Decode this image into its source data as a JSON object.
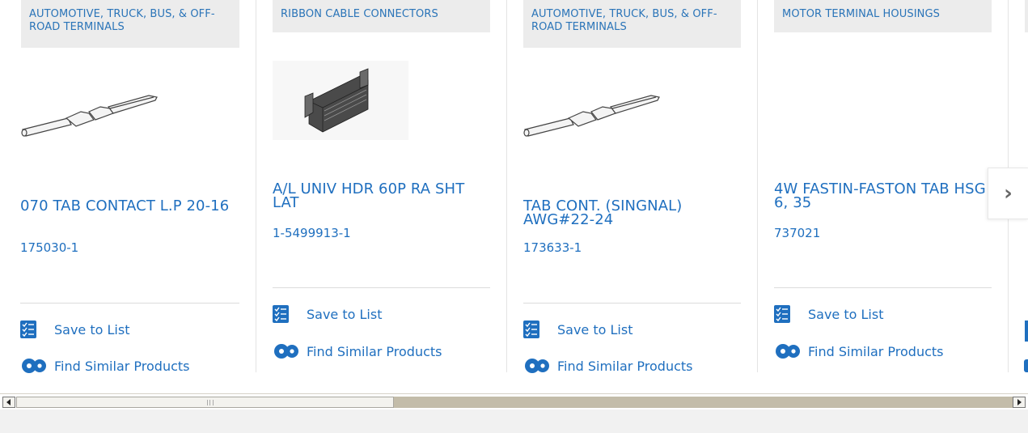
{
  "cards": [
    {
      "category": "AUTOMOTIVE, TRUCK, BUS, & OFF-ROAD TERMINALS",
      "name": "070 TAB CONTACT L.P 20-16",
      "part_number": "175030-1",
      "image": "tab-contact-terminal-image",
      "save_label": "Save to List",
      "similar_label": "Find Similar Products"
    },
    {
      "category": "RIBBON CABLE CONNECTORS",
      "name": "A/L UNIV HDR 60P RA SHT LAT",
      "part_number": "1-5499913-1",
      "image": "ribbon-header-connector-image",
      "save_label": "Save to List",
      "similar_label": "Find Similar Products"
    },
    {
      "category": "AUTOMOTIVE, TRUCK, BUS, & OFF-ROAD TERMINALS",
      "name": "TAB CONT. (SINGNAL) AWG#22-24",
      "part_number": "173633-1",
      "image": "tab-contact-terminal-image",
      "save_label": "Save to List",
      "similar_label": "Find Similar Products"
    },
    {
      "category": "MOTOR TERMINAL HOUSINGS",
      "name": "4W FASTIN-FASTON TAB HSG 6, 35",
      "part_number": "737021",
      "image": "",
      "save_label": "Save to List",
      "similar_label": "Find Similar Products"
    }
  ],
  "colors": {
    "link_blue": "#1f6fbf",
    "category_bg": "#ececec",
    "scroll_track": "#c3bca9"
  },
  "icons": {
    "save": "checklist-icon",
    "similar": "gears-icon",
    "next": "chevron-right-icon",
    "scroll_left": "scroll-left-arrow-icon",
    "scroll_right": "scroll-right-arrow-icon"
  },
  "carousel": {
    "next_glyph": "›"
  }
}
